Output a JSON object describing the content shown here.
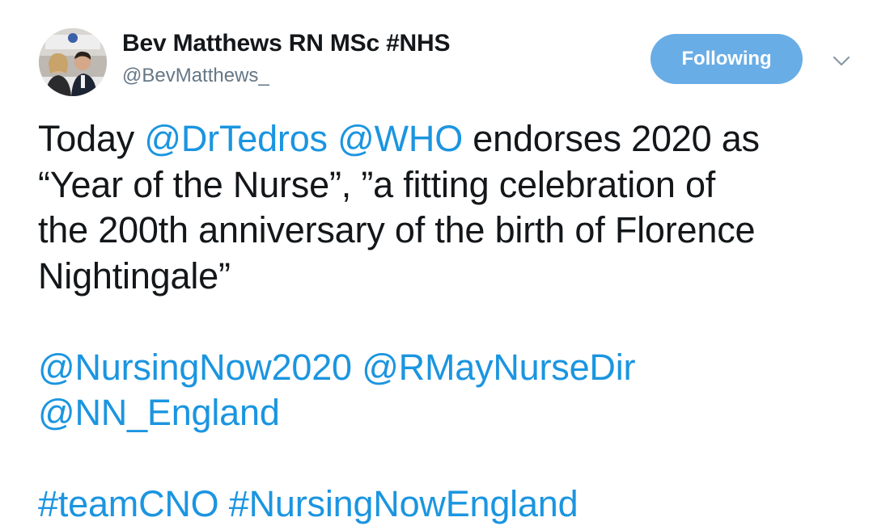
{
  "author": {
    "name": "Bev Matthews RN MSc #NHS",
    "handle": "@BevMatthews_"
  },
  "follow_button": {
    "label": "Following"
  },
  "menu_caret": {
    "icon": "chevron-down-icon"
  },
  "tweet": {
    "paragraph1": {
      "line1": {
        "before": "Today ",
        "mention1": "@DrTedros",
        "space": " ",
        "mention2": "@WHO",
        "after": " endorses 2020 as"
      },
      "line2": "“Year of the Nurse”, ”a fitting celebration of",
      "line3": "the 200th anniversary of the birth of Florence",
      "line4": "Nightingale”"
    },
    "paragraph2": {
      "mention1": "@NursingNow2020",
      "mention2": "@RMayNurseDir",
      "mention3": "@NN_England"
    },
    "paragraph3": {
      "hashtag1": "#teamCNO",
      "hashtag2": "#NursingNowEngland"
    }
  },
  "colors": {
    "link": "#1b95e0",
    "follow_button_bg": "#69ade6",
    "text": "#14171a",
    "secondary_text": "#657786"
  }
}
